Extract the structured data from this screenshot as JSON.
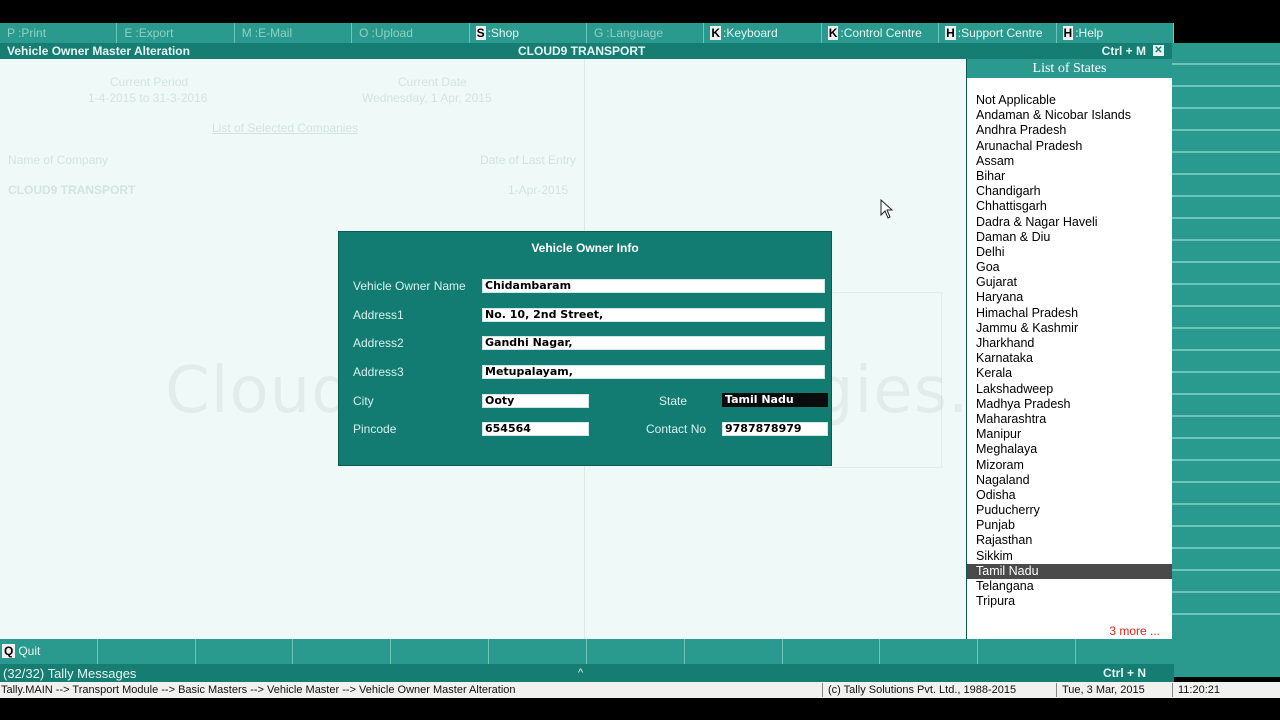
{
  "topbar": {
    "items": [
      {
        "key": "P",
        "label": "Print"
      },
      {
        "key": "E",
        "label": "Export"
      },
      {
        "key": "M",
        "label": "E-Mail"
      },
      {
        "key": "O",
        "label": "Upload"
      },
      {
        "key": "S",
        "label": "Shop"
      },
      {
        "key": "G",
        "label": "Language"
      },
      {
        "key": "K",
        "label": "Keyboard"
      },
      {
        "key": "K",
        "label": "Control Centre"
      },
      {
        "key": "H",
        "label": "Support Centre"
      },
      {
        "key": "H",
        "label": "Help"
      }
    ]
  },
  "titlebar": {
    "left": "Vehicle Owner Master Alteration",
    "center": "CLOUD9 TRANSPORT",
    "right": "Ctrl + M"
  },
  "background": {
    "current_period_label": "Current Period",
    "current_period": "1-4-2015 to 31-3-2016",
    "current_date_label": "Current Date",
    "current_date": "Wednesday, 1 Apr, 2015",
    "list_heading": "List of Selected Companies",
    "name_col": "Name of Company",
    "date_col": "Date of Last Entry",
    "company": "CLOUD9 TRANSPORT",
    "company_date": "1-Apr-2015",
    "watermark": "Cloud9SoftTechnologies.Com"
  },
  "dialog": {
    "title": "Vehicle Owner Info",
    "fields": {
      "owner_name": {
        "label": "Vehicle Owner Name",
        "value": "Chidambaram"
      },
      "address1": {
        "label": "Address1",
        "value": "No. 10, 2nd Street,"
      },
      "address2": {
        "label": "Address2",
        "value": "Gandhi Nagar,"
      },
      "address3": {
        "label": "Address3",
        "value": "Metupalayam,"
      },
      "city": {
        "label": "City",
        "value": "Ooty"
      },
      "state": {
        "label": "State",
        "value": "Tamil Nadu"
      },
      "pincode": {
        "label": "Pincode",
        "value": "654564"
      },
      "contact": {
        "label": "Contact No",
        "value": "9787878979"
      }
    }
  },
  "list_panel": {
    "title": "List of States",
    "items": [
      "Not Applicable",
      "Andaman & Nicobar Islands",
      "Andhra Pradesh",
      "Arunachal Pradesh",
      "Assam",
      "Bihar",
      "Chandigarh",
      "Chhattisgarh",
      "Dadra & Nagar Haveli",
      "Daman & Diu",
      "Delhi",
      "Goa",
      "Gujarat",
      "Haryana",
      "Himachal Pradesh",
      "Jammu & Kashmir",
      "Jharkhand",
      "Karnataka",
      "Kerala",
      "Lakshadweep",
      "Madhya Pradesh",
      "Maharashtra",
      "Manipur",
      "Meghalaya",
      "Mizoram",
      "Nagaland",
      "Odisha",
      "Puducherry",
      "Punjab",
      "Rajasthan",
      "Sikkim",
      "Tamil Nadu",
      "Telangana",
      "Tripura"
    ],
    "selected": "Tamil Nadu",
    "more": "3 more ..."
  },
  "bottombar": {
    "quit_key": "Q",
    "quit_label": "Quit"
  },
  "msgbar": {
    "left": "(32/32) Tally Messages",
    "center": "^",
    "right": "Ctrl + N"
  },
  "statusbar": {
    "path": "Tally.MAIN --> Transport Module --> Basic Masters --> Vehicle Master --> Vehicle Owner Master Alteration",
    "copyright": "(c) Tally Solutions Pvt. Ltd., 1988-2015",
    "date": "Tue, 3 Mar, 2015",
    "time": "11:20:21"
  },
  "colors": {
    "teal": "#2b9a8e",
    "teal_dark": "#137c72",
    "workarea": "#effaf8",
    "accent_red": "#d9261c"
  }
}
